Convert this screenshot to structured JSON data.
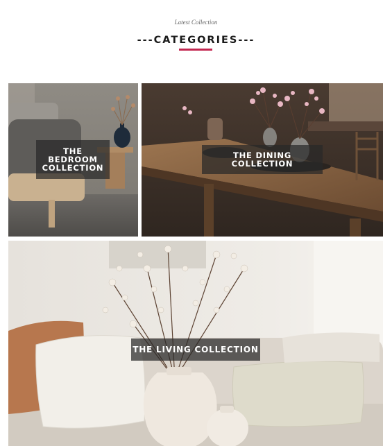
{
  "header": {
    "eyebrow": "Latest Collection",
    "title": "---CATEGORIES---"
  },
  "colors": {
    "accent": "#c2264f",
    "label_background": "#2a2a2a"
  },
  "categories": [
    {
      "lines": [
        "THE",
        "BEDROOM",
        "COLLECTION"
      ]
    },
    {
      "lines": [
        "THE DINING",
        "COLLECTION"
      ]
    },
    {
      "lines": [
        "THE LIVING COLLECTION"
      ]
    }
  ]
}
